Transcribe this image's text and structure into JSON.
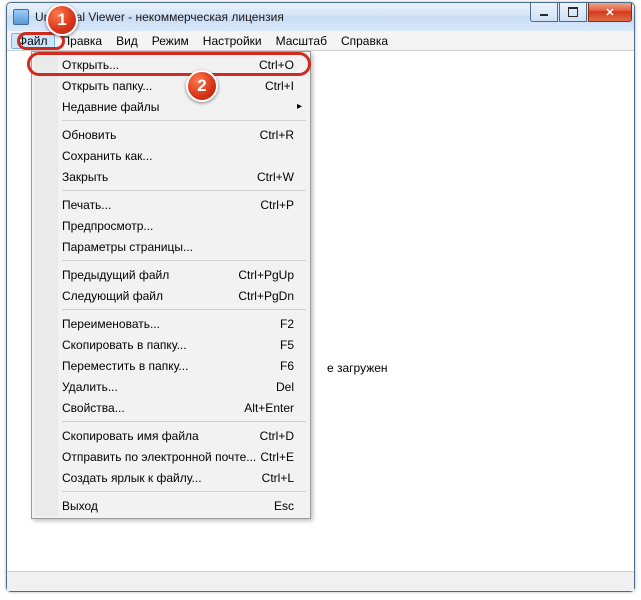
{
  "window": {
    "title": "Universal Viewer - некоммерческая лицензия"
  },
  "menubar": [
    "Файл",
    "Правка",
    "Вид",
    "Режим",
    "Настройки",
    "Масштаб",
    "Справка"
  ],
  "content": {
    "status_text": "е загружен"
  },
  "dropdown": {
    "groups": [
      [
        {
          "label": "Открыть...",
          "shortcut": "Ctrl+O"
        },
        {
          "label": "Открыть папку...",
          "shortcut": "Ctrl+I"
        },
        {
          "label": "Недавние файлы",
          "shortcut": "",
          "arrow": true
        }
      ],
      [
        {
          "label": "Обновить",
          "shortcut": "Ctrl+R"
        },
        {
          "label": "Сохранить как...",
          "shortcut": ""
        },
        {
          "label": "Закрыть",
          "shortcut": "Ctrl+W"
        }
      ],
      [
        {
          "label": "Печать...",
          "shortcut": "Ctrl+P"
        },
        {
          "label": "Предпросмотр...",
          "shortcut": ""
        },
        {
          "label": "Параметры страницы...",
          "shortcut": ""
        }
      ],
      [
        {
          "label": "Предыдущий файл",
          "shortcut": "Ctrl+PgUp"
        },
        {
          "label": "Следующий файл",
          "shortcut": "Ctrl+PgDn"
        }
      ],
      [
        {
          "label": "Переименовать...",
          "shortcut": "F2"
        },
        {
          "label": "Скопировать в папку...",
          "shortcut": "F5"
        },
        {
          "label": "Переместить в папку...",
          "shortcut": "F6"
        },
        {
          "label": "Удалить...",
          "shortcut": "Del"
        },
        {
          "label": "Свойства...",
          "shortcut": "Alt+Enter"
        }
      ],
      [
        {
          "label": "Скопировать имя файла",
          "shortcut": "Ctrl+D"
        },
        {
          "label": "Отправить по электронной почте...",
          "shortcut": "Ctrl+E"
        },
        {
          "label": "Создать ярлык к файлу...",
          "shortcut": "Ctrl+L"
        }
      ],
      [
        {
          "label": "Выход",
          "shortcut": "Esc"
        }
      ]
    ]
  },
  "badges": {
    "one": "1",
    "two": "2"
  }
}
